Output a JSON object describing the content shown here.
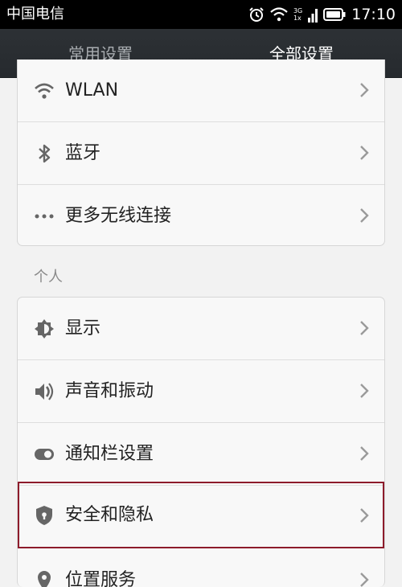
{
  "status_bar": {
    "carrier": "中国电信",
    "network_top": "3G",
    "network_bottom": "1x",
    "time": "17:10"
  },
  "tabs": [
    {
      "label": "常用设置",
      "active": false
    },
    {
      "label": "全部设置",
      "active": true
    }
  ],
  "wireless": {
    "items": [
      {
        "label": "WLAN",
        "icon": "wifi-icon"
      },
      {
        "label": "蓝牙",
        "icon": "bluetooth-icon"
      },
      {
        "label": "更多无线连接",
        "icon": "more-dots-icon"
      }
    ]
  },
  "personal": {
    "header": "个人",
    "items": [
      {
        "label": "显示",
        "icon": "brightness-icon"
      },
      {
        "label": "声音和振动",
        "icon": "sound-icon"
      },
      {
        "label": "通知栏设置",
        "icon": "toggle-icon"
      },
      {
        "label": "安全和隐私",
        "icon": "shield-icon",
        "highlighted": true
      },
      {
        "label": "位置服务",
        "icon": "location-icon"
      }
    ]
  },
  "colors": {
    "highlight_border": "#8d1b2b",
    "header_bg": "#2d3135"
  }
}
